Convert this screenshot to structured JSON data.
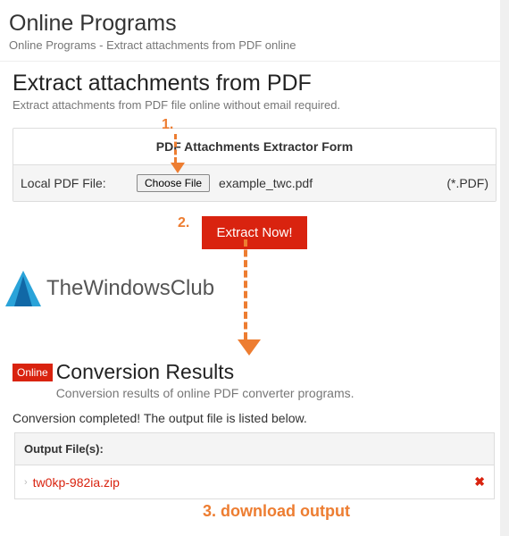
{
  "header": {
    "title": "Online Programs",
    "subtitle": "Online Programs - Extract attachments from PDF online"
  },
  "page": {
    "title": "Extract attachments from PDF",
    "subtitle": "Extract attachments from PDF file online without email required."
  },
  "form": {
    "title": "PDF Attachments Extractor Form",
    "file_label": "Local PDF File:",
    "choose_button": "Choose File",
    "selected_file": "example_twc.pdf",
    "ext_hint": "(*.PDF)",
    "submit_label": "Extract Now!"
  },
  "brand": {
    "name": "TheWindowsClub"
  },
  "results": {
    "badge": "Online",
    "title": "Conversion Results",
    "subtitle": "Conversion results of online PDF converter programs.",
    "completed_msg": "Conversion completed! The output file is listed below.",
    "output_heading": "Output File(s):",
    "files": [
      {
        "name": "tw0kp-982ia.zip"
      }
    ]
  },
  "annotations": {
    "step1": "1.",
    "step2": "2.",
    "step3": "3. download output"
  }
}
